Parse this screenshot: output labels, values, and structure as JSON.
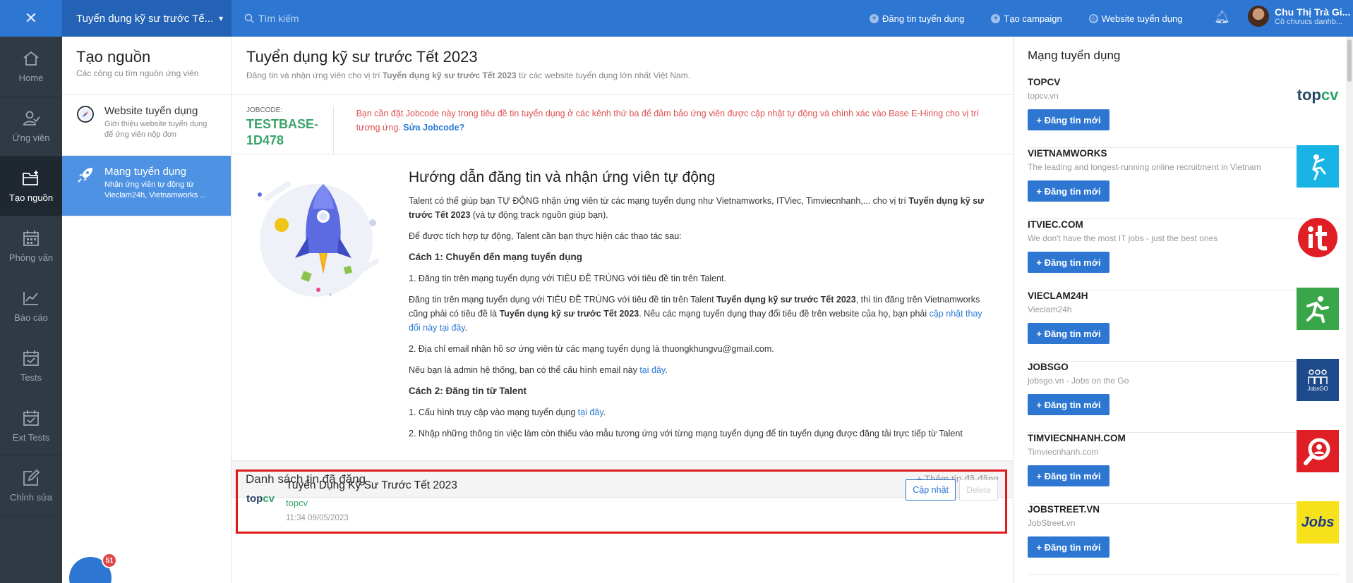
{
  "topbar": {
    "close_icon": "close-icon",
    "job_title": "Tuyển dụng kỹ sư trước Tế...",
    "search_placeholder": "Tìm kiếm",
    "actions": [
      {
        "label": "Đăng tin tuyển dụng",
        "icon": "plus-circle-icon"
      },
      {
        "label": "Tạo campaign",
        "icon": "plus-circle-icon"
      },
      {
        "label": "Website tuyển dụng",
        "icon": "globe-icon"
      }
    ],
    "user_name": "Chu Thị Trà Gi...",
    "user_role": "Cô chưucs danhb..."
  },
  "leftnav": [
    {
      "label": "Home",
      "icon": "home-icon"
    },
    {
      "label": "Ứng viên",
      "icon": "candidate-icon"
    },
    {
      "label": "Tạo nguồn",
      "icon": "folder-plus-icon",
      "active": true
    },
    {
      "label": "Phỏng vấn",
      "icon": "calendar-icon"
    },
    {
      "label": "Báo cáo",
      "icon": "chart-icon"
    },
    {
      "label": "Tests",
      "icon": "calendar-check-icon"
    },
    {
      "label": "Ext Tests",
      "icon": "calendar-check-icon"
    },
    {
      "label": "Chỉnh sửa",
      "icon": "edit-icon"
    }
  ],
  "subnav": {
    "title": "Tạo nguồn",
    "subtitle": "Các công cụ tìm nguồn ứng viên",
    "items": [
      {
        "title": "Website tuyển dụng",
        "desc": "Giới thiệu website tuyển dụng để ứng viên nộp đơn"
      },
      {
        "title": "Mạng tuyển dụng",
        "desc": "Nhận ứng viên tự động từ Vieclam24h, Vietnamworks ..."
      }
    ],
    "badge_count": "51"
  },
  "main": {
    "title": "Tuyển dụng kỹ sư trước Tết 2023",
    "subtitle_pre": "Đăng tin và nhận ứng viên cho vị trí ",
    "subtitle_bold": "Tuyển dụng kỹ sư trước Tết 2023",
    "subtitle_post": " từ các website tuyển dụng lớn nhất Việt Nam.",
    "jobcode_label": "JOBCODE:",
    "jobcode_value": "TESTBASE-1D478",
    "jobcode_msg": "Bạn cần đặt Jobcode này trong tiêu đề tin tuyển dụng ở các kênh thứ ba để đảm bảo ứng viên được cập nhật tự động và chính xác vào Base E-Hiring cho vị trí tương ứng.",
    "jobcode_link": "Sửa Jobcode?",
    "guide": {
      "title": "Hướng dẫn đăng tin và nhận ứng viên tự động",
      "p1_pre": "Talent có thể giúp bạn TỰ ĐỘNG nhận ứng viên từ các mạng tuyển dụng như Vietnamworks, ITViec, Timviecnhanh,... cho vị trí ",
      "p1_bold": "Tuyển dụng kỹ sư trước Tết 2023",
      "p1_post": " (và tự động track nguồn giúp bạn).",
      "p2": "Để được tích hợp tự động, Talent cần bạn thực hiện các thao tác sau:",
      "h1": "Cách 1: Chuyển đến mạng tuyển dụng",
      "s1": "1. Đăng tin trên mạng tuyển dụng với TIÊU ĐỀ TRÙNG với tiêu đề tin trên Talent.",
      "s2_a": "Đăng tin trên mạng tuyển dụng với TIÊU ĐỀ TRÙNG với tiêu đề tin trên Talent ",
      "s2_b": "Tuyển dụng kỹ sư trước Tết 2023",
      "s2_c": ", thì tin đăng trên Vietnamworks cũng phải có tiêu đề là ",
      "s2_d": "Tuyển dụng kỹ sư trước Tết 2023",
      "s2_e": ". Nếu các mạng tuyển dụng thay đổi tiêu đề trên website của họ, bạn phải ",
      "s2_link": "cập nhật thay đổi này tại đây",
      "s2_end": ".",
      "s3": "2. Địa chỉ email nhận hồ sơ ứng viên từ các mạng tuyển dụng là thuongkhungvu@gmail.com.",
      "s4_pre": "Nếu bạn là admin hệ thống, bạn có thể cấu hình email này ",
      "s4_link": "tại đây",
      "s4_end": ".",
      "h2": "Cách 2: Đăng tin từ Talent",
      "s5_pre": "1. Cấu hình truy cập vào mạng tuyển dụng ",
      "s5_link": "tại đây",
      "s5_end": ".",
      "s6": "2. Nhập những thông tin việc làm còn thiếu vào mẫu tương ứng với từng mạng tuyển dụng để tin tuyển dụng được đăng tải trực tiếp từ Talent"
    },
    "posted": {
      "title": "Danh sách tin đã đăng",
      "add": "+ Thêm tin đã đăng",
      "item": {
        "logo_a": "top",
        "logo_b": "cv",
        "title": "Tuyển Dụng Kỹ Sư Trước Tết 2023",
        "source": "topcv",
        "time": "11:34 09/05/2023",
        "update": "Cập nhật",
        "delete": "Delete"
      }
    }
  },
  "right": {
    "title": "Mạng tuyển dụng",
    "button_label": "+ Đăng tin mới",
    "networks": [
      {
        "name": "TOPCV",
        "desc": "topcv.vn",
        "color": "#ffffff"
      },
      {
        "name": "VIETNAMWORKS",
        "desc": "The leading and longest-running online recruitment in Vietnam",
        "color": "#18b4e6"
      },
      {
        "name": "ITVIEC.COM",
        "desc": "We don't have the most IT jobs - just the best ones",
        "color": "#e01e25"
      },
      {
        "name": "VIECLAM24H",
        "desc": "Vieclam24h",
        "color": "#3aa64a"
      },
      {
        "name": "JOBSGO",
        "desc": "jobsgo.vn - Jobs on the Go",
        "color": "#1d4a8a"
      },
      {
        "name": "TIMVIECNHANH.COM",
        "desc": "Timviecnhanh.com",
        "color": "#e01e25"
      },
      {
        "name": "JOBSTREET.VN",
        "desc": "JobStreet.vn",
        "color": "#f7e11b"
      }
    ],
    "logos": {
      "topcv_a": "top",
      "topcv_b": "cv",
      "jobsgo": "JobsGO",
      "jobstreet": "Jobs"
    }
  }
}
